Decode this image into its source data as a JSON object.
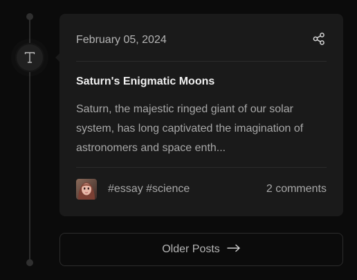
{
  "post": {
    "date": "February 05, 2024",
    "title": "Saturn's Enigmatic Moons",
    "excerpt": "Saturn, the majestic ringed giant of our solar system, has long captivated the imagination of astronomers and space enth...",
    "tags": [
      "#essay",
      "#science"
    ],
    "comments": "2 comments",
    "type_icon": "text-type-icon",
    "share_icon": "share-icon"
  },
  "pagination": {
    "older_label": "Older Posts",
    "older_icon": "arrow-right-icon"
  }
}
